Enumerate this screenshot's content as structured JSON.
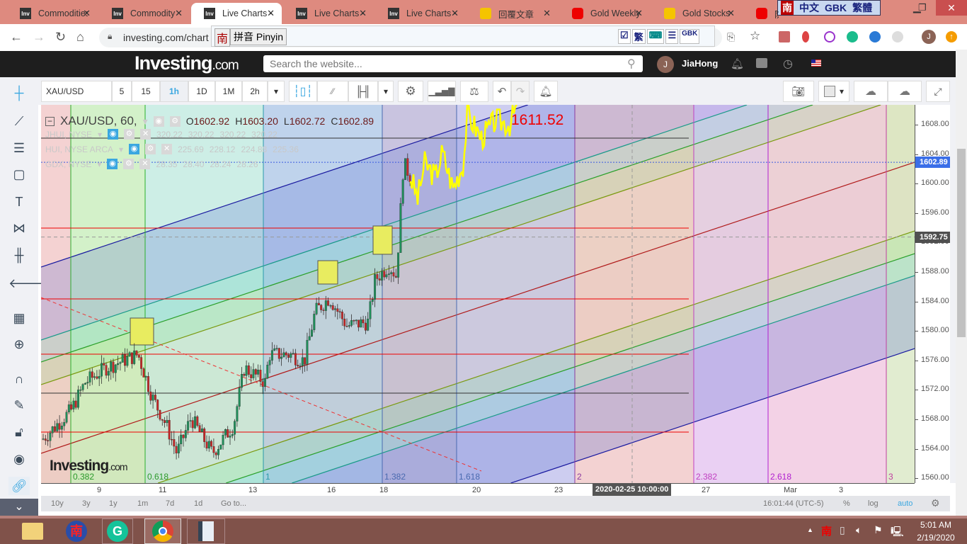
{
  "browser": {
    "tabs": [
      {
        "label": "Commodities",
        "icon": "investing-icon"
      },
      {
        "label": "Commodity",
        "icon": "investing-icon"
      },
      {
        "label": "Live Charts -",
        "icon": "investing-icon",
        "active": true
      },
      {
        "label": "Live Charts -",
        "icon": "investing-icon"
      },
      {
        "label": "Live Charts -",
        "icon": "investing-icon"
      },
      {
        "label": "回覆文章",
        "icon": "gem-icon"
      },
      {
        "label": "Gold Weekly",
        "icon": "youtube-icon"
      },
      {
        "label": "Gold Stocks",
        "icon": "gem-icon"
      },
      {
        "label": "防",
        "icon": "youtube-icon"
      }
    ],
    "url": "investing.com/chart",
    "ime_bar": [
      "南",
      "中文",
      "GBK",
      "繁體"
    ],
    "ime_input": {
      "logo": "南",
      "mode": "拼音 Pinyin",
      "buttons": [
        "☑",
        "繁",
        "⌨",
        "☰",
        "GBK"
      ]
    }
  },
  "site": {
    "logo": "Investing",
    "logo_suffix": ".com",
    "search_placeholder": "Search the website...",
    "user_initial": "J",
    "user_name": "JiaHong"
  },
  "toolbar": {
    "symbol": "XAU/USD",
    "intervals": [
      "5",
      "15",
      "1h",
      "1D",
      "1M",
      "2h"
    ],
    "active_interval": "1h"
  },
  "legend": {
    "title": "XAU/USD, 60,",
    "o_label": "O",
    "o": "1602.92",
    "h_label": "H",
    "h": "1603.20",
    "l_label": "L",
    "l": "1602.72",
    "c_label": "C",
    "c": "1602.89",
    "overlays": [
      {
        "name": "JHUI, NYSE",
        "values": [
          "320.22",
          "320.22",
          "320.22",
          "320.22"
        ]
      },
      {
        "name": "HUI, NYSE ARCA",
        "values": [
          "225.69",
          "228.12",
          "224.88",
          "225.36"
        ]
      },
      {
        "name": "GDX, NYSE",
        "values": [
          "28.35",
          "28.40",
          "28.24",
          "28.26"
        ]
      }
    ]
  },
  "chart_data": {
    "type": "candlestick",
    "symbol": "XAU/USD",
    "interval": "60",
    "watermark": "Investing.com",
    "projection_label": "1611.52",
    "price_ticks": [
      "1608.00",
      "1604.00",
      "1600.00",
      "1596.00",
      "1592.00",
      "1588.00",
      "1584.00",
      "1580.00",
      "1576.00",
      "1572.00",
      "1568.00",
      "1564.00",
      "1560.00"
    ],
    "last_price": "1602.89",
    "crosshair_price": "1592.75",
    "crosshair_time": "2020-02-25 10:00:00",
    "time_ticks": [
      "9",
      "11",
      "13",
      "16",
      "18",
      "20",
      "23",
      "27",
      "Mar",
      "3"
    ],
    "fib_time_zones": [
      "0.382",
      "0.618",
      "1",
      "1.382",
      "1.618",
      "2",
      "2.382",
      "2.618",
      "3"
    ],
    "horizontal_levels": [
      1593.6,
      1584.0,
      1576.5,
      1571.8,
      1566.0,
      1605.0
    ],
    "price_path": [
      [
        0.05,
        1565.3
      ],
      [
        0.97,
        1569.2
      ],
      [
        1.43,
        1573
      ],
      [
        2.11,
        1575
      ],
      [
        3.15,
        1576.8
      ],
      [
        3.61,
        1571
      ],
      [
        4.07,
        1567.2
      ],
      [
        4.41,
        1563.4
      ],
      [
        4.87,
        1568.2
      ],
      [
        5.56,
        1563.4
      ],
      [
        6.25,
        1567.2
      ],
      [
        6.6,
        1575
      ],
      [
        7.29,
        1573
      ],
      [
        7.4,
        1576.8
      ],
      [
        8.09,
        1576.8
      ],
      [
        8.55,
        1575.9
      ],
      [
        8.9,
        1582.6
      ],
      [
        9.36,
        1584.5
      ],
      [
        9.93,
        1580.7
      ],
      [
        10.62,
        1581.2
      ],
      [
        10.85,
        1587
      ],
      [
        11.31,
        1588.9
      ],
      [
        11.54,
        1587.4
      ],
      [
        11.77,
        1602.8
      ],
      [
        12.0,
        1600.9
      ]
    ],
    "projection_path": [
      [
        12.0,
        1600.9
      ],
      [
        12.23,
        1598
      ],
      [
        12.46,
        1602.8
      ],
      [
        12.8,
        1600.9
      ],
      [
        13.03,
        1604.3
      ],
      [
        13.38,
        1599.4
      ],
      [
        13.72,
        1602.8
      ],
      [
        13.84,
        1609.5
      ],
      [
        14.3,
        1606.2
      ],
      [
        14.76,
        1608.6
      ],
      [
        15.22,
        1608.1
      ],
      [
        15.45,
        1610.5
      ]
    ]
  },
  "bottom": {
    "ranges": [
      "10y",
      "3y",
      "1y",
      "1m",
      "7d",
      "1d",
      "Go to..."
    ],
    "clock": "16:01:44 (UTC-5)",
    "pct": "%",
    "log": "log",
    "auto": "auto"
  },
  "taskbar": {
    "time": "5:01 AM",
    "date": "2/19/2020"
  },
  "colors": {
    "up": "#26a69a",
    "down": "#e53935",
    "accent": "#3aa7e0",
    "projection": "#ffff00"
  }
}
